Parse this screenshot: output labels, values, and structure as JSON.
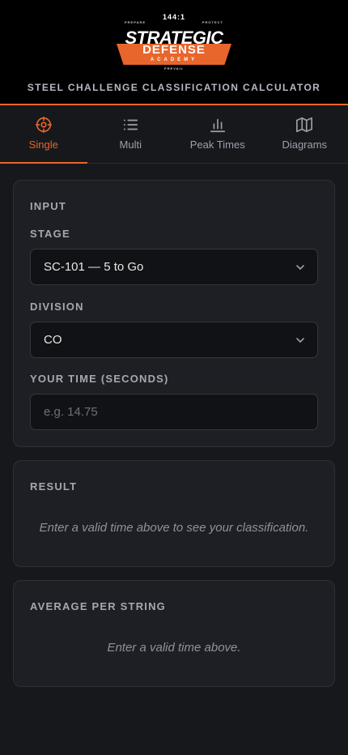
{
  "header": {
    "logo": {
      "top": "144:1",
      "small_left": "PREPARE",
      "small_right": "PROTECT",
      "main": "STRATEGIC",
      "secondary": "DEFENSE",
      "academy": "ACADEMY",
      "bottom": "PREVAIL"
    },
    "subtitle": "STEEL CHALLENGE CLASSIFICATION CALCULATOR"
  },
  "tabs": [
    {
      "label": "Single",
      "icon": "crosshair-icon",
      "active": true
    },
    {
      "label": "Multi",
      "icon": "list-icon",
      "active": false
    },
    {
      "label": "Peak Times",
      "icon": "bar-chart-icon",
      "active": false
    },
    {
      "label": "Diagrams",
      "icon": "map-icon",
      "active": false
    }
  ],
  "input": {
    "title": "INPUT",
    "stage_label": "STAGE",
    "stage_value": "SC-101 — 5 to Go",
    "division_label": "DIVISION",
    "division_value": "CO",
    "time_label": "YOUR TIME (SECONDS)",
    "time_placeholder": "e.g. 14.75"
  },
  "result": {
    "title": "RESULT",
    "message": "Enter a valid time above to see your classification."
  },
  "average": {
    "title": "AVERAGE PER STRING",
    "message": "Enter a valid time above."
  },
  "colors": {
    "accent": "#e8652c",
    "background": "#17181c",
    "card": "#1e1f24",
    "field": "#111215"
  }
}
